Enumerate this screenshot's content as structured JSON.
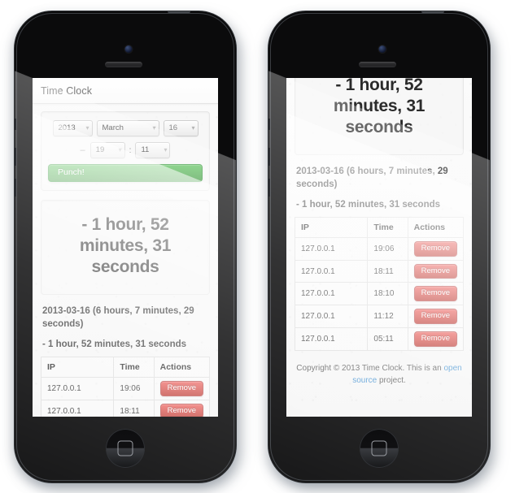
{
  "app": {
    "navbar_title": "Time Clock"
  },
  "punch_form": {
    "year": "2013",
    "month": "March",
    "day": "16",
    "dash": "–",
    "hour": "19",
    "colon": ":",
    "minute": "11",
    "chevron": "▾",
    "punch_label": "Punch!"
  },
  "total_display": {
    "text": "- 1 hour, 52 minutes, 31 seconds"
  },
  "day_entry": {
    "heading": "2013-03-16 (6 hours, 7 minutes, 29 seconds)",
    "subtotal": "- 1 hour, 52 minutes, 31 seconds"
  },
  "table": {
    "columns": [
      "IP",
      "Time",
      "Actions"
    ],
    "remove_label": "Remove",
    "rows": [
      {
        "ip": "127.0.0.1",
        "time": "19:06"
      },
      {
        "ip": "127.0.0.1",
        "time": "18:11"
      },
      {
        "ip": "127.0.0.1",
        "time": "18:10"
      },
      {
        "ip": "127.0.0.1",
        "time": "11:12"
      },
      {
        "ip": "127.0.0.1",
        "time": "05:11"
      }
    ]
  },
  "footer": {
    "text_before": "Copyright © 2013 Time Clock. This is an ",
    "link": "open source",
    "text_after": " project."
  },
  "colors": {
    "punch_green": "#51a351",
    "remove_red": "#bd362f",
    "link_blue": "#3f8fd0",
    "navbar_title": "#7c7c7c",
    "device_black": "#0b0b0c"
  }
}
